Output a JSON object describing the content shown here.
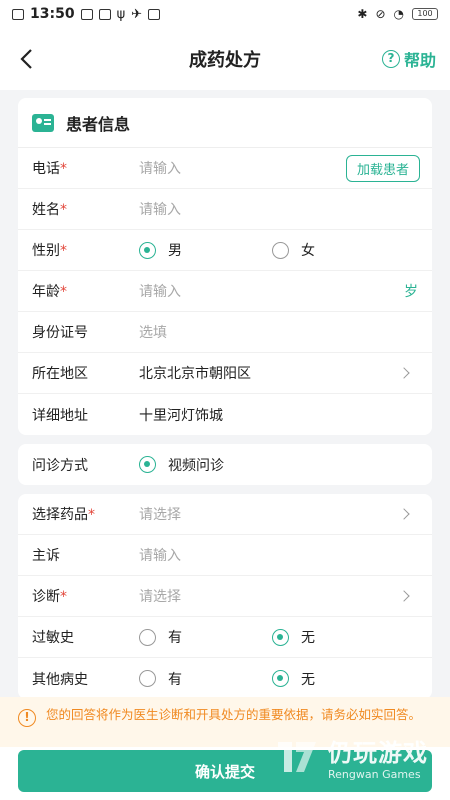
{
  "status_bar": {
    "time": "13:50",
    "battery": "100"
  },
  "nav": {
    "title": "成药处方",
    "help_label": "帮助"
  },
  "patient_card": {
    "title": "患者信息",
    "phone": {
      "label": "电话",
      "placeholder": "请输入",
      "action": "加载患者"
    },
    "name": {
      "label": "姓名",
      "placeholder": "请输入"
    },
    "gender": {
      "label": "性别",
      "options": [
        "男",
        "女"
      ],
      "selected": "男"
    },
    "age": {
      "label": "年龄",
      "placeholder": "请输入",
      "unit": "岁"
    },
    "id_number": {
      "label": "身份证号",
      "placeholder": "选填"
    },
    "region": {
      "label": "所在地区",
      "value": "北京北京市朝阳区"
    },
    "address": {
      "label": "详细地址",
      "value": "十里河灯饰城"
    }
  },
  "consult_card": {
    "label": "问诊方式",
    "option": "视频问诊"
  },
  "rx_card": {
    "medicine": {
      "label": "选择药品",
      "placeholder": "请选择"
    },
    "complaint": {
      "label": "主诉",
      "placeholder": "请输入"
    },
    "diagnosis": {
      "label": "诊断",
      "placeholder": "请选择"
    },
    "allergy": {
      "label": "过敏史",
      "options": [
        "有",
        "无"
      ],
      "selected": "无"
    },
    "other_history": {
      "label": "其他病史",
      "options": [
        "有",
        "无"
      ],
      "selected": "无"
    }
  },
  "notice": {
    "text": "您的回答将作为医生诊断和开具处方的重要依据，请务必如实回答。"
  },
  "submit_label": "确认提交",
  "watermark": {
    "cn": "仍玩游戏",
    "en": "Rengwan Games"
  },
  "colors": {
    "accent": "#2bb394",
    "required": "#e2463a",
    "warning": "#f08a22"
  }
}
